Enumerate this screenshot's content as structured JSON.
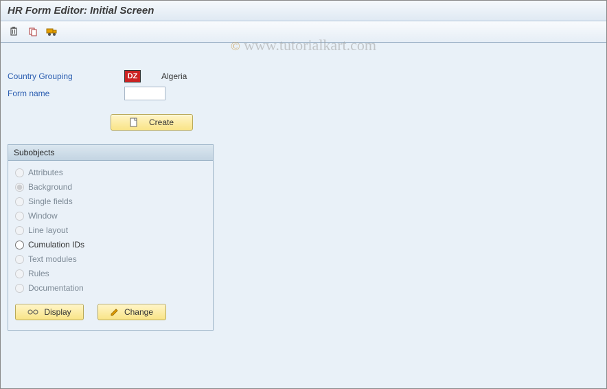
{
  "title": "HR Form Editor: Initial Screen",
  "watermark": "www.tutorialkart.com",
  "fields": {
    "country_grouping_label": "Country Grouping",
    "country_code": "DZ",
    "country_name": "Algeria",
    "form_name_label": "Form name",
    "form_name_value": ""
  },
  "buttons": {
    "create": "Create",
    "display": "Display",
    "change": "Change"
  },
  "subobjects": {
    "header": "Subobjects",
    "items": [
      {
        "label": "Attributes",
        "selected": false,
        "enabled": false
      },
      {
        "label": "Background",
        "selected": true,
        "enabled": false
      },
      {
        "label": "Single fields",
        "selected": false,
        "enabled": false
      },
      {
        "label": "Window",
        "selected": false,
        "enabled": false
      },
      {
        "label": "Line layout",
        "selected": false,
        "enabled": false
      },
      {
        "label": "Cumulation IDs",
        "selected": false,
        "enabled": true
      },
      {
        "label": "Text modules",
        "selected": false,
        "enabled": false
      },
      {
        "label": "Rules",
        "selected": false,
        "enabled": false
      },
      {
        "label": "Documentation",
        "selected": false,
        "enabled": false
      }
    ]
  }
}
